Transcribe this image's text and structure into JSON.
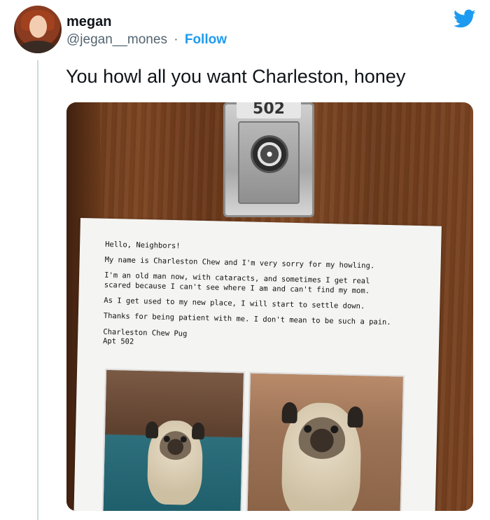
{
  "user": {
    "display_name": "megan",
    "handle": "@jegan__mones",
    "separator": "·",
    "follow_label": "Follow"
  },
  "tweet": {
    "text": "You howl all you want Charleston, honey"
  },
  "photo": {
    "door_number": "502",
    "flyer": {
      "greeting": "Hello, Neighbors!",
      "line1": "My name is Charleston Chew and I'm very sorry for my howling.",
      "line2": "I'm an old man now, with cataracts, and sometimes I get real scared because I can't see where I am and can't find my mom.",
      "line3": "As I get used to my new place, I will start to settle down.",
      "line4": "Thanks for being patient with me. I don't mean to be such a pain.",
      "signature_name": "Charleston Chew Pug",
      "signature_apt": "Apt 502"
    }
  },
  "icons": {
    "brand": "twitter-bird-icon"
  },
  "colors": {
    "accent": "#1d9bf0",
    "secondary_text": "#536471",
    "primary_text": "#0f1419"
  }
}
